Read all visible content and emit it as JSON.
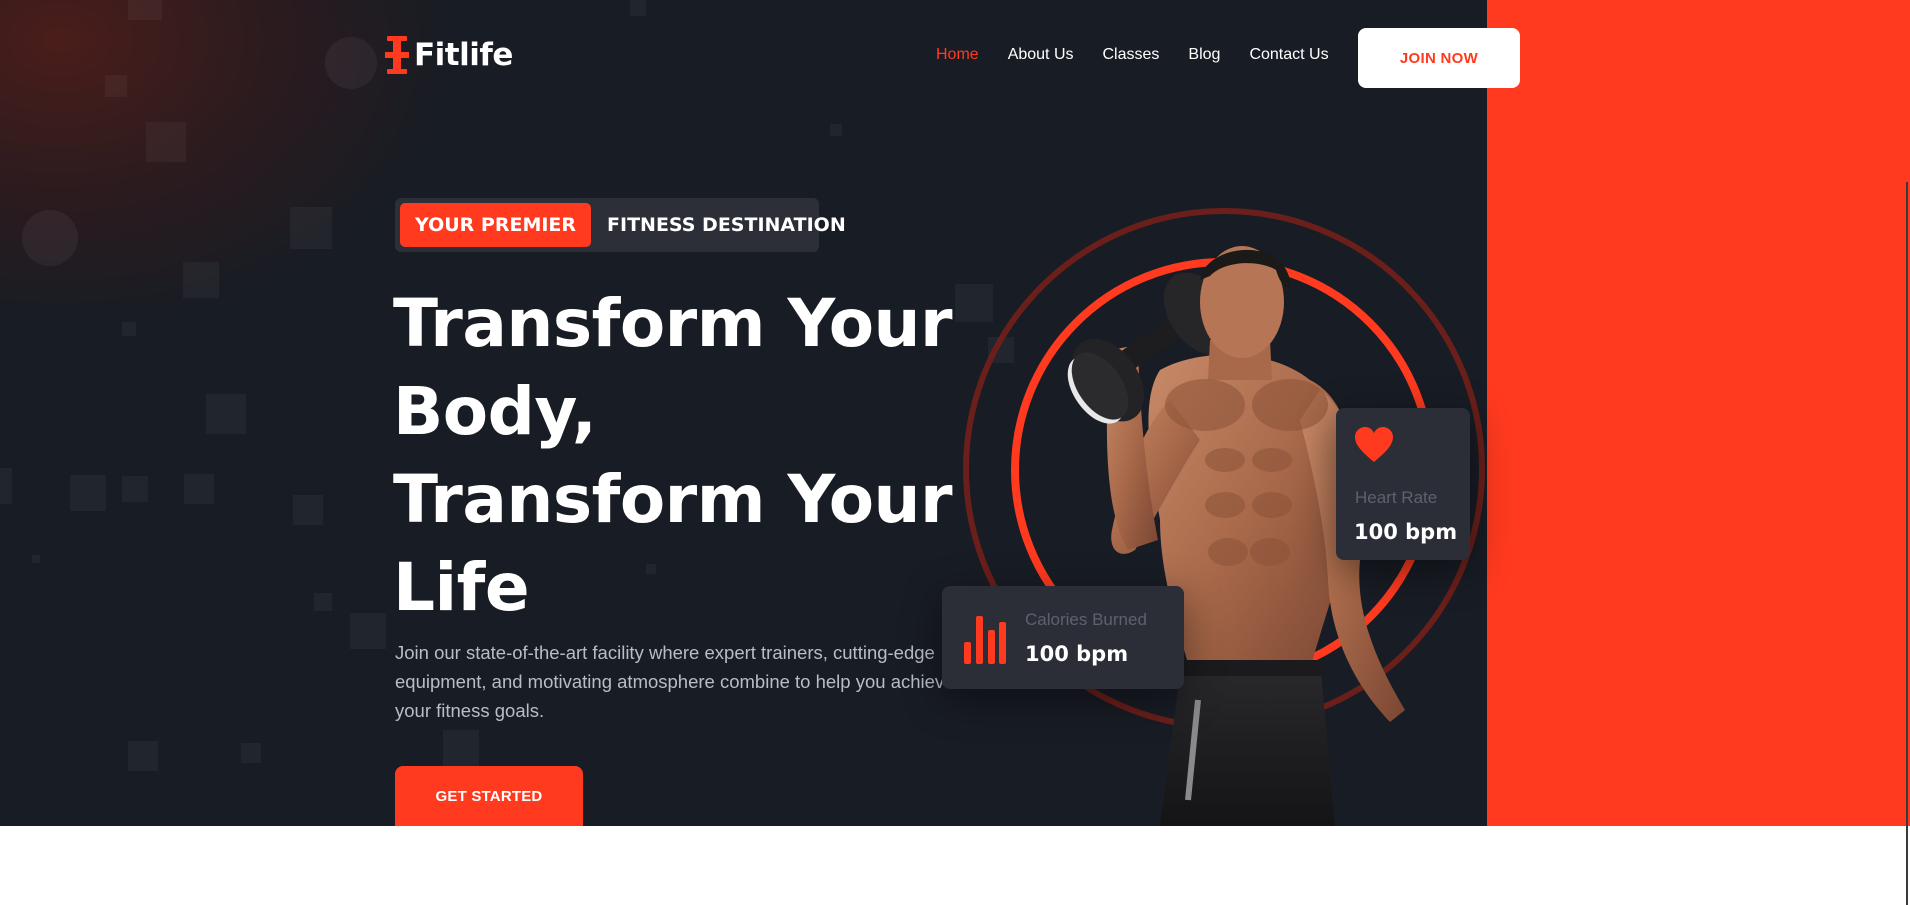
{
  "brand": {
    "name": "Fitlife",
    "accent": "#ff3a1f",
    "dark": "#181c24"
  },
  "nav": {
    "items": [
      {
        "label": "Home",
        "active": true
      },
      {
        "label": "About Us",
        "active": false
      },
      {
        "label": "Classes",
        "active": false
      },
      {
        "label": "Blog",
        "active": false
      },
      {
        "label": "Contact Us",
        "active": false
      }
    ],
    "cta_label": "JOIN NOW"
  },
  "hero": {
    "badge_highlight": "YOUR PREMIER",
    "badge_rest": "FITNESS DESTINATION",
    "headline_lines": [
      "Transform Your",
      "Body,",
      "Transform Your",
      "Life"
    ],
    "description": "Join our state-of-the-art facility where expert trainers, cutting-edge equipment, and motivating atmosphere combine to help you achieve your fitness goals.",
    "cta_label": "GET STARTED"
  },
  "stats": {
    "heart_rate": {
      "label": "Heart Rate",
      "value": "100 bpm",
      "icon": "heart-icon"
    },
    "calories": {
      "label": "Calories Burned",
      "value": "100 bpm",
      "icon": "bar-chart-icon"
    }
  }
}
